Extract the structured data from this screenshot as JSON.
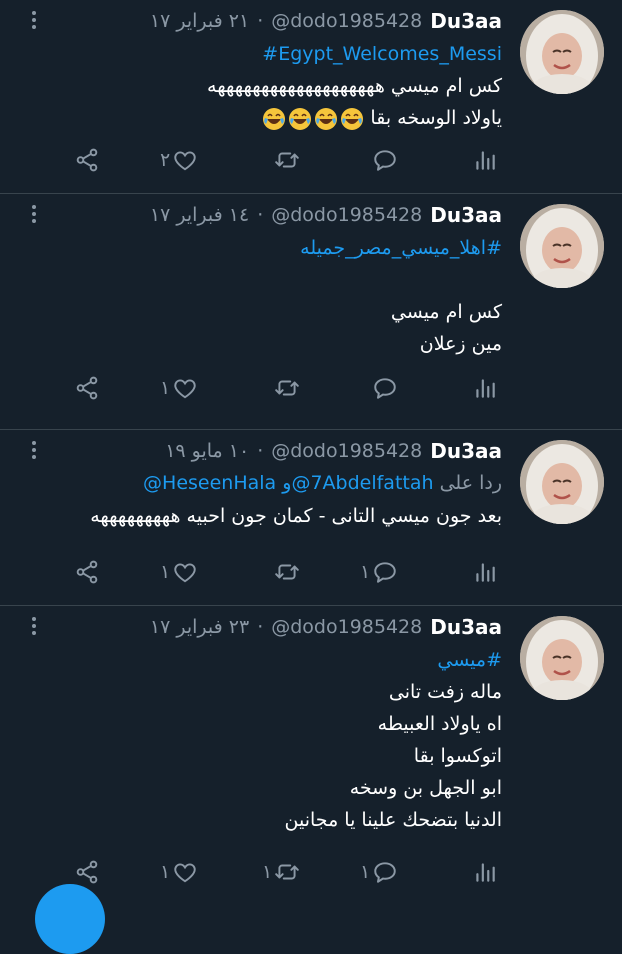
{
  "colors": {
    "background": "#15202b",
    "accent": "#1d9bf0",
    "muted": "#8b98a5",
    "divider": "#38444d"
  },
  "icons": [
    "more-icon",
    "share-icon",
    "like-icon",
    "retweet-icon",
    "reply-icon",
    "analytics-icon"
  ],
  "tweets": [
    {
      "name": "Du3aa",
      "handle": "@dodo1985428",
      "date": "٢١ فبراير ١٧",
      "hashtag": "#Egypt_Welcomes_Messi",
      "lines": [
        "كس ام ميسي هههههههههههههههههههه",
        "ياولاد الوسخه بقا"
      ],
      "likes": "٢",
      "replies": "",
      "retweets": ""
    },
    {
      "name": "Du3aa",
      "handle": "@dodo1985428",
      "date": "١٤ فبراير ١٧",
      "hashtag": "#اهلا_ميسي_مصر_جميله",
      "lines": [
        "كس ام ميسي",
        "مين زعلان"
      ],
      "likes": "١",
      "replies": "",
      "retweets": ""
    },
    {
      "name": "Du3aa",
      "handle": "@dodo1985428",
      "date": "١٠ مايو ١٩",
      "reply_prefix": "ردا على",
      "mention1": "@7Abdelfattah",
      "mention_join": "و",
      "mention2": "@HeseenHala",
      "lines": [
        "بعد جون ميسي التانى - كمان جون احبيه  هههههههههه"
      ],
      "likes": "١",
      "replies": "١",
      "retweets": ""
    },
    {
      "name": "Du3aa",
      "handle": "@dodo1985428",
      "date": "٢٣ فبراير ١٧",
      "hashtag": "#ميسي",
      "lines": [
        "ماله زفت  تانى",
        "اه ياولاد العبيطه",
        "اتوكسوا بقا",
        "ابو الجهل بن وسخه",
        "الدنيا بتضحك  علينا يا مجانين"
      ],
      "likes": "١",
      "replies": "١",
      "retweets": "١"
    }
  ]
}
